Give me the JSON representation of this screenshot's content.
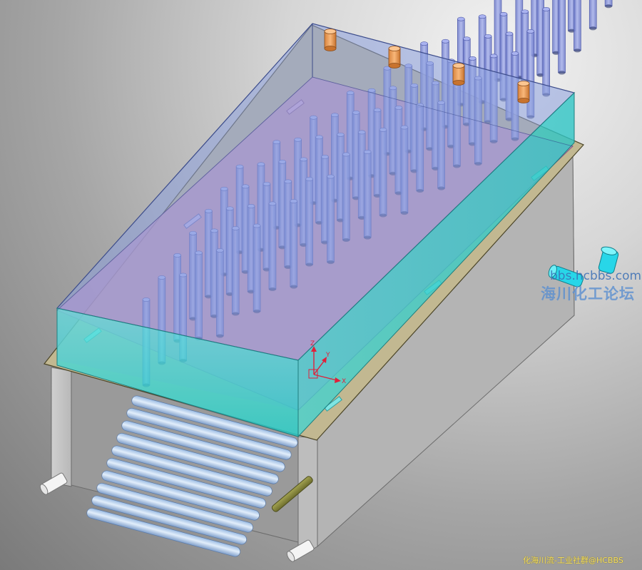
{
  "viewport": {
    "triad": {
      "x_label": "X",
      "y_label": "Y",
      "z_label": "Z"
    }
  },
  "watermark": {
    "url": "bbs.hcbbs.com",
    "name": "海川化工论坛"
  },
  "credit": "化海川流-工业社群@HCBBS",
  "colors": {
    "background_center": "#eeeeee",
    "background_edge": "#7a7a7a",
    "tank_top": "#8c9ad8",
    "tank_front": "#33d3d3",
    "tank_interior": "#c88bc0",
    "tube": "#7d89d6",
    "nozzle": "#f0a060",
    "rod": "#8a8a3c",
    "coil_pipe": "#b9d4ef",
    "triad": "#e0203a"
  },
  "objects": {
    "top_nozzles": [
      "nozzle",
      "nozzle",
      "nozzle",
      "nozzle"
    ],
    "tube_grid": {
      "rows": 7,
      "cols": 11
    },
    "coil_pipes": 10,
    "support_rods": 2,
    "inlet_outlet_pipes": 2,
    "side_elbow": 1,
    "slots": 6
  }
}
